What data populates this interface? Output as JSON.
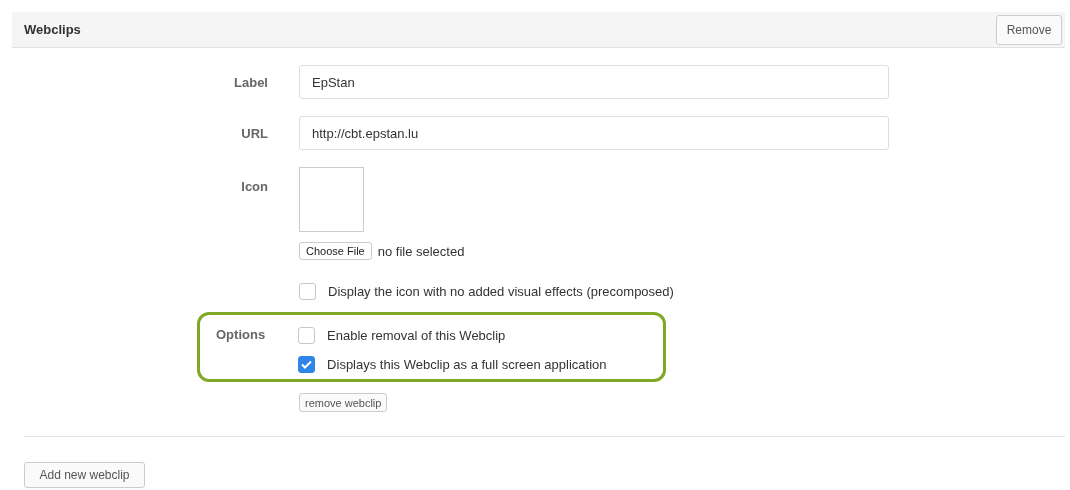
{
  "header": {
    "title": "Webclips",
    "remove_button": "Remove"
  },
  "fields": [
    {
      "label": "Label",
      "value": "EpStan"
    },
    {
      "label": "URL",
      "value": "http://cbt.epstan.lu"
    }
  ],
  "icon": {
    "label": "Icon",
    "choose_button": "Choose File",
    "file_status": "no file selected"
  },
  "precomposed": {
    "label": "Display the icon with no added visual effects (precomposed)",
    "checked": false
  },
  "options": {
    "label": "Options",
    "highlighted": true,
    "items": [
      {
        "label": "Enable removal of this Webclip",
        "checked": false
      },
      {
        "label": "Displays this Webclip as a full screen application",
        "checked": true
      }
    ]
  },
  "remove_webclip_button": "remove webclip",
  "add_button": "Add new webclip"
}
